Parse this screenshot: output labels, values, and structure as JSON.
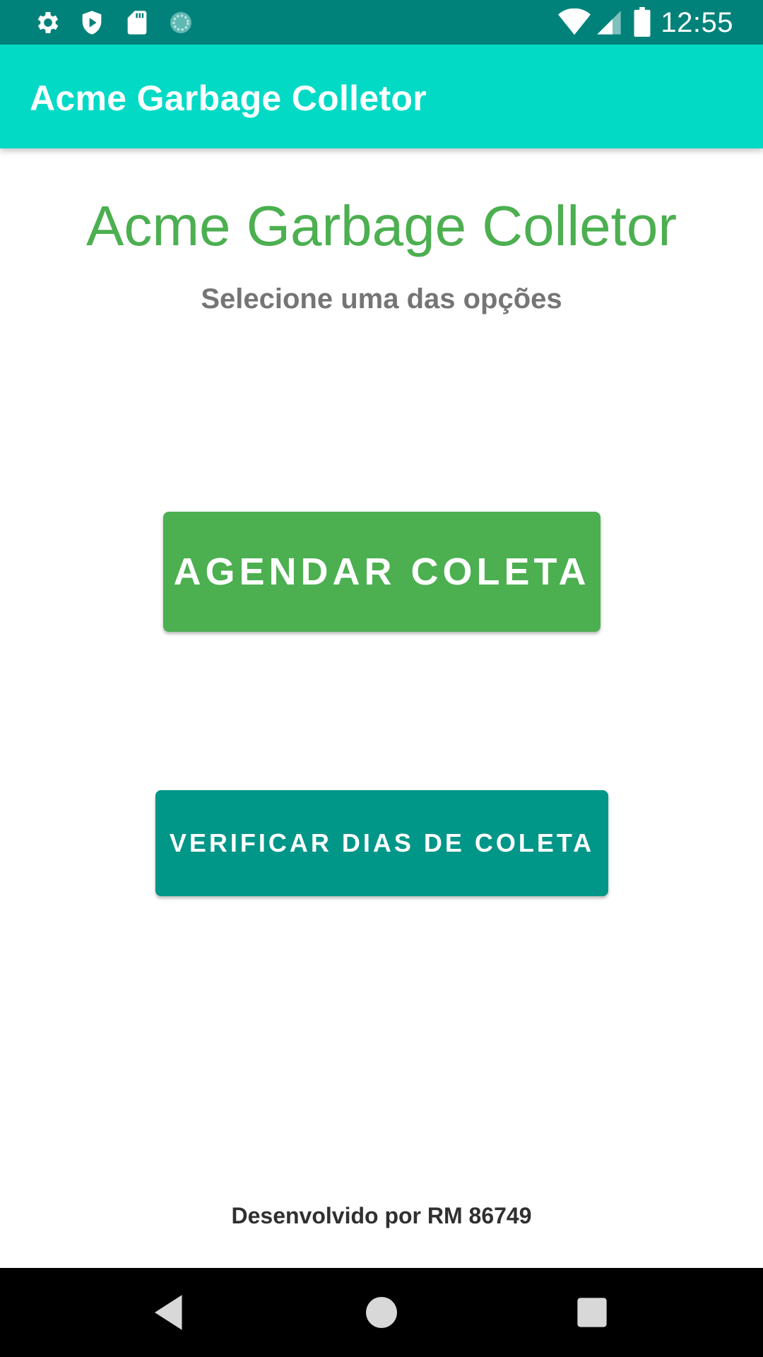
{
  "status_bar": {
    "time": "12:55",
    "left_icons": [
      "gear-icon",
      "shield-play-icon",
      "sd-card-icon",
      "sync-circle-icon"
    ],
    "right_icons": [
      "wifi-icon",
      "signal-icon",
      "battery-icon"
    ]
  },
  "app_bar": {
    "title": "Acme Garbage Colletor",
    "color": "#03dac5"
  },
  "main": {
    "title": "Acme Garbage Colletor",
    "subtitle": "Selecione uma das opções",
    "primary_button_label": "AGENDAR COLETA",
    "secondary_button_label": "VERIFICAR DIAS DE COLETA",
    "footer": "Desenvolvido por RM 86749"
  },
  "colors": {
    "status_bar": "#00827a",
    "accent_green": "#4caf50",
    "teal": "#009688"
  },
  "nav_bar": {
    "icons": [
      "back-icon",
      "home-icon",
      "recents-icon"
    ]
  }
}
